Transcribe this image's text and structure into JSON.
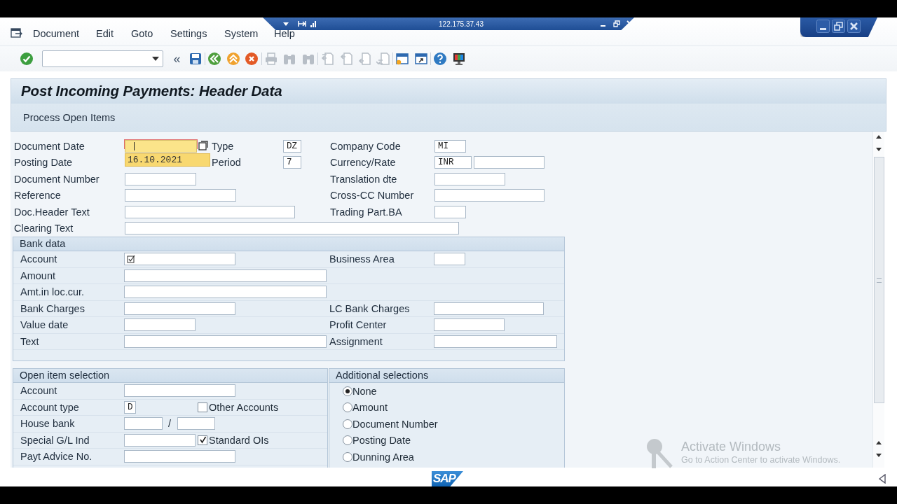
{
  "session_bar": {
    "address": "122.175.37.43"
  },
  "menu": [
    "Document",
    "Edit",
    "Goto",
    "Settings",
    "System",
    "Help"
  ],
  "toolbar": [
    {
      "kind": "enter",
      "disabled": false
    },
    {
      "kind": "command_field"
    },
    {
      "kind": "glyph",
      "label": "«"
    },
    {
      "kind": "save",
      "disabled": false
    },
    {
      "kind": "back",
      "disabled": false
    },
    {
      "kind": "exit",
      "disabled": false
    },
    {
      "kind": "cancel",
      "disabled": false
    },
    {
      "kind": "print",
      "disabled": true
    },
    {
      "kind": "find",
      "disabled": true
    },
    {
      "kind": "find_next",
      "disabled": true
    },
    {
      "kind": "first_page",
      "disabled": true
    },
    {
      "kind": "previous_page",
      "disabled": true
    },
    {
      "kind": "next_page",
      "disabled": true
    },
    {
      "kind": "last_page",
      "disabled": true
    },
    {
      "kind": "new_session",
      "disabled": false
    },
    {
      "kind": "shortcut",
      "disabled": false
    },
    {
      "kind": "help",
      "disabled": false
    },
    {
      "kind": "layout",
      "disabled": false
    }
  ],
  "screen_title": "Post Incoming Payments: Header Data",
  "app_toolbar": [
    {
      "label": "Process Open Items"
    }
  ],
  "header": {
    "rows": [
      {
        "items": [
          {
            "kind": "label",
            "text": "Document Date"
          },
          {
            "kind": "input",
            "value": "",
            "focused": true,
            "suggestion": "16.10.2021"
          },
          {
            "kind": "value_help"
          },
          {
            "kind": "label",
            "text": "Type"
          },
          {
            "kind": "input",
            "value": "DZ",
            "focused": false
          },
          {
            "kind": "label",
            "text": "Company Code"
          },
          {
            "kind": "input",
            "value": "MI",
            "focused": false
          }
        ]
      },
      {
        "items": [
          {
            "kind": "label",
            "text": "Posting Date"
          },
          {
            "kind": "label",
            "text": "Period"
          },
          {
            "kind": "input",
            "value": "7",
            "focused": false
          },
          {
            "kind": "label",
            "text": "Currency/Rate"
          },
          {
            "kind": "input",
            "value": "INR",
            "focused": false
          },
          {
            "kind": "input",
            "value": "",
            "focused": false
          }
        ]
      },
      {
        "items": [
          {
            "kind": "label",
            "text": "Document Number"
          },
          {
            "kind": "input",
            "value": "",
            "focused": false
          },
          {
            "kind": "label",
            "text": "Translation dte"
          },
          {
            "kind": "input",
            "value": "",
            "focused": false
          }
        ]
      },
      {
        "items": [
          {
            "kind": "label",
            "text": "Reference"
          },
          {
            "kind": "input",
            "value": "",
            "focused": false
          },
          {
            "kind": "label",
            "text": "Cross-CC Number"
          },
          {
            "kind": "input",
            "value": "",
            "focused": false
          }
        ]
      },
      {
        "items": [
          {
            "kind": "label",
            "text": "Doc.Header Text"
          },
          {
            "kind": "input",
            "value": "",
            "focused": false
          },
          {
            "kind": "label",
            "text": "Trading Part.BA"
          },
          {
            "kind": "input",
            "value": "",
            "focused": false
          }
        ]
      },
      {
        "items": [
          {
            "kind": "label",
            "text": "Clearing Text"
          },
          {
            "kind": "input",
            "value": "",
            "focused": false
          }
        ]
      }
    ]
  },
  "bank_data": {
    "title": "Bank data",
    "rows": [
      {
        "items": [
          {
            "kind": "label",
            "text": "Account"
          },
          {
            "kind": "required_input",
            "value": "",
            "focused": false
          },
          {
            "kind": "label",
            "text": "Business Area"
          },
          {
            "kind": "input",
            "value": "",
            "focused": false
          }
        ]
      },
      {
        "items": [
          {
            "kind": "label",
            "text": "Amount"
          },
          {
            "kind": "input",
            "value": "",
            "focused": false
          }
        ]
      },
      {
        "items": [
          {
            "kind": "label",
            "text": "Amt.in loc.cur."
          },
          {
            "kind": "input",
            "value": "",
            "focused": false
          }
        ]
      },
      {
        "items": [
          {
            "kind": "label",
            "text": "Bank Charges"
          },
          {
            "kind": "input",
            "value": "",
            "focused": false
          },
          {
            "kind": "label",
            "text": "LC Bank Charges"
          },
          {
            "kind": "input",
            "value": "",
            "focused": false
          }
        ]
      },
      {
        "items": [
          {
            "kind": "label",
            "text": "Value date"
          },
          {
            "kind": "input",
            "value": "",
            "focused": false
          },
          {
            "kind": "label",
            "text": "Profit Center"
          },
          {
            "kind": "input",
            "value": "",
            "focused": false
          }
        ]
      },
      {
        "items": [
          {
            "kind": "label",
            "text": "Text"
          },
          {
            "kind": "input",
            "value": "",
            "focused": false
          },
          {
            "kind": "label",
            "text": "Assignment"
          },
          {
            "kind": "input",
            "value": "",
            "focused": false
          }
        ]
      }
    ]
  },
  "open_item_selection": {
    "title": "Open item selection",
    "rows": [
      {
        "items": [
          {
            "kind": "label",
            "text": "Account"
          },
          {
            "kind": "input",
            "value": "",
            "focused": false
          }
        ]
      },
      {
        "items": [
          {
            "kind": "label",
            "text": "Account type"
          },
          {
            "kind": "input",
            "value": "D",
            "focused": false
          },
          {
            "kind": "checkbox",
            "label": "Other Accounts",
            "checked": false
          }
        ]
      },
      {
        "items": [
          {
            "kind": "label",
            "text": "House bank"
          },
          {
            "kind": "input",
            "value": "",
            "focused": false
          },
          {
            "kind": "text",
            "text": "/"
          },
          {
            "kind": "input",
            "value": "",
            "focused": false
          }
        ]
      },
      {
        "items": [
          {
            "kind": "label",
            "text": "Special G/L Ind"
          },
          {
            "kind": "input",
            "value": "",
            "focused": false
          },
          {
            "kind": "checkbox",
            "label": "Standard OIs",
            "checked": true
          }
        ]
      },
      {
        "items": [
          {
            "kind": "label",
            "text": "Payt Advice No."
          },
          {
            "kind": "input",
            "value": "",
            "focused": false
          }
        ]
      }
    ]
  },
  "additional_selections": {
    "title": "Additional selections",
    "options": [
      {
        "label": "None",
        "selected": true
      },
      {
        "label": "Amount",
        "selected": false
      },
      {
        "label": "Document Number",
        "selected": false
      },
      {
        "label": "Posting Date",
        "selected": false
      },
      {
        "label": "Dunning Area",
        "selected": false
      }
    ]
  },
  "status_bar": {
    "logo": "SAP"
  },
  "os_notice": {
    "title": "Activate Windows",
    "text": "Go to Action Center to activate Windows."
  }
}
